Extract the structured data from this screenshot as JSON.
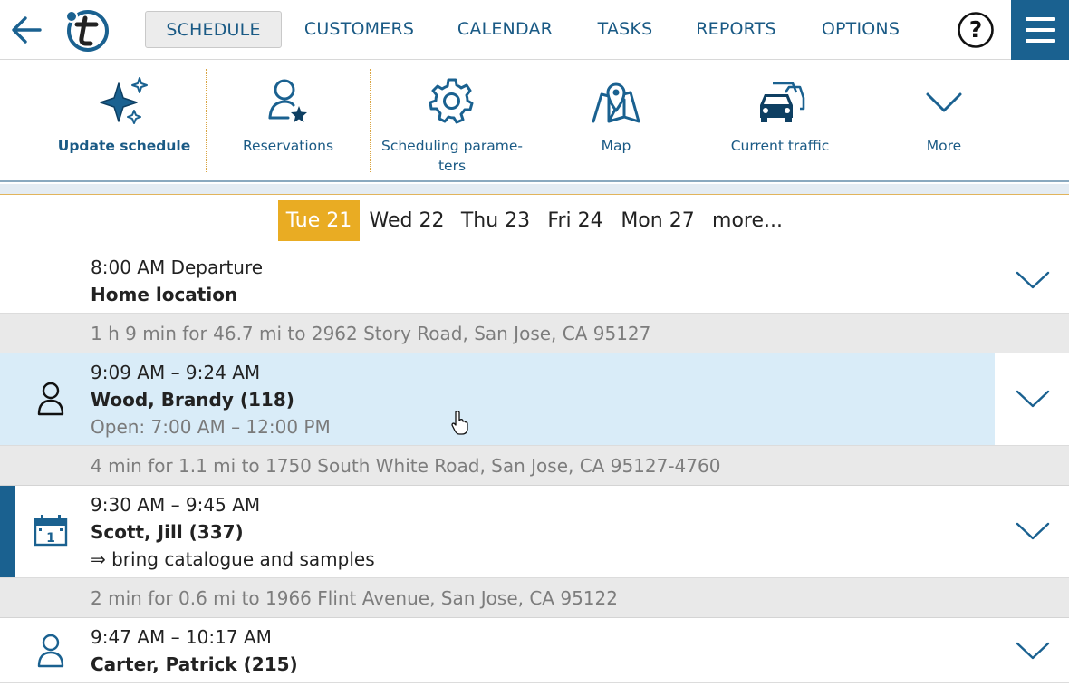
{
  "nav": {
    "items": [
      {
        "label": "SCHEDULE",
        "active": true
      },
      {
        "label": "CUSTOMERS",
        "active": false
      },
      {
        "label": "CALENDAR",
        "active": false
      },
      {
        "label": "TASKS",
        "active": false
      },
      {
        "label": "REPORTS",
        "active": false
      },
      {
        "label": "OPTIONS",
        "active": false
      }
    ],
    "help_label": "?"
  },
  "toolbar": {
    "items": [
      {
        "label": "Update schedule",
        "icon": "sparkle-icon"
      },
      {
        "label": "Reservations",
        "icon": "person-star-icon"
      },
      {
        "label": "Scheduling parame-\nters",
        "icon": "gear-icon"
      },
      {
        "label": "Map",
        "icon": "map-icon"
      },
      {
        "label": "Current traffic",
        "icon": "traffic-icon"
      },
      {
        "label": "More",
        "icon": "chevron-down-icon"
      }
    ]
  },
  "days": {
    "items": [
      {
        "label": "Tue 21",
        "active": true
      },
      {
        "label": "Wed 22",
        "active": false
      },
      {
        "label": "Thu 23",
        "active": false
      },
      {
        "label": "Fri 24",
        "active": false
      },
      {
        "label": "Mon 27",
        "active": false
      },
      {
        "label": "more...",
        "active": false
      }
    ]
  },
  "schedule": {
    "departure": {
      "time": "8:00 AM Departure",
      "place": "Home location"
    },
    "travel": [
      "1 h 9 min for 46.7 mi to 2962 Story Road, San Jose, CA 95127",
      "4 min for 1.1 mi to 1750 South White Road, San Jose, CA 95127-4760",
      "2 min for 0.6 mi to 1966 Flint Avenue, San Jose, CA 95122"
    ],
    "appointments": [
      {
        "time": "9:09 AM – 9:24 AM",
        "name": "Wood, Brandy (118)",
        "note": "Open: 7:00 AM – 12:00 PM",
        "icon": "person-icon"
      },
      {
        "time": "9:30 AM – 9:45 AM",
        "name": "Scott, Jill (337)",
        "note": "⇒ bring catalogue and samples",
        "icon": "calendar-icon",
        "calendar_day": "1"
      },
      {
        "time": "9:47 AM – 10:17 AM",
        "name": "Carter, Patrick (215)",
        "icon": "person-icon"
      }
    ]
  },
  "colors": {
    "brand_blue": "#1a6190",
    "accent_orange": "#e9ac23",
    "selected_row": "#d9ecf8",
    "travel_band": "#e9e9e9"
  }
}
